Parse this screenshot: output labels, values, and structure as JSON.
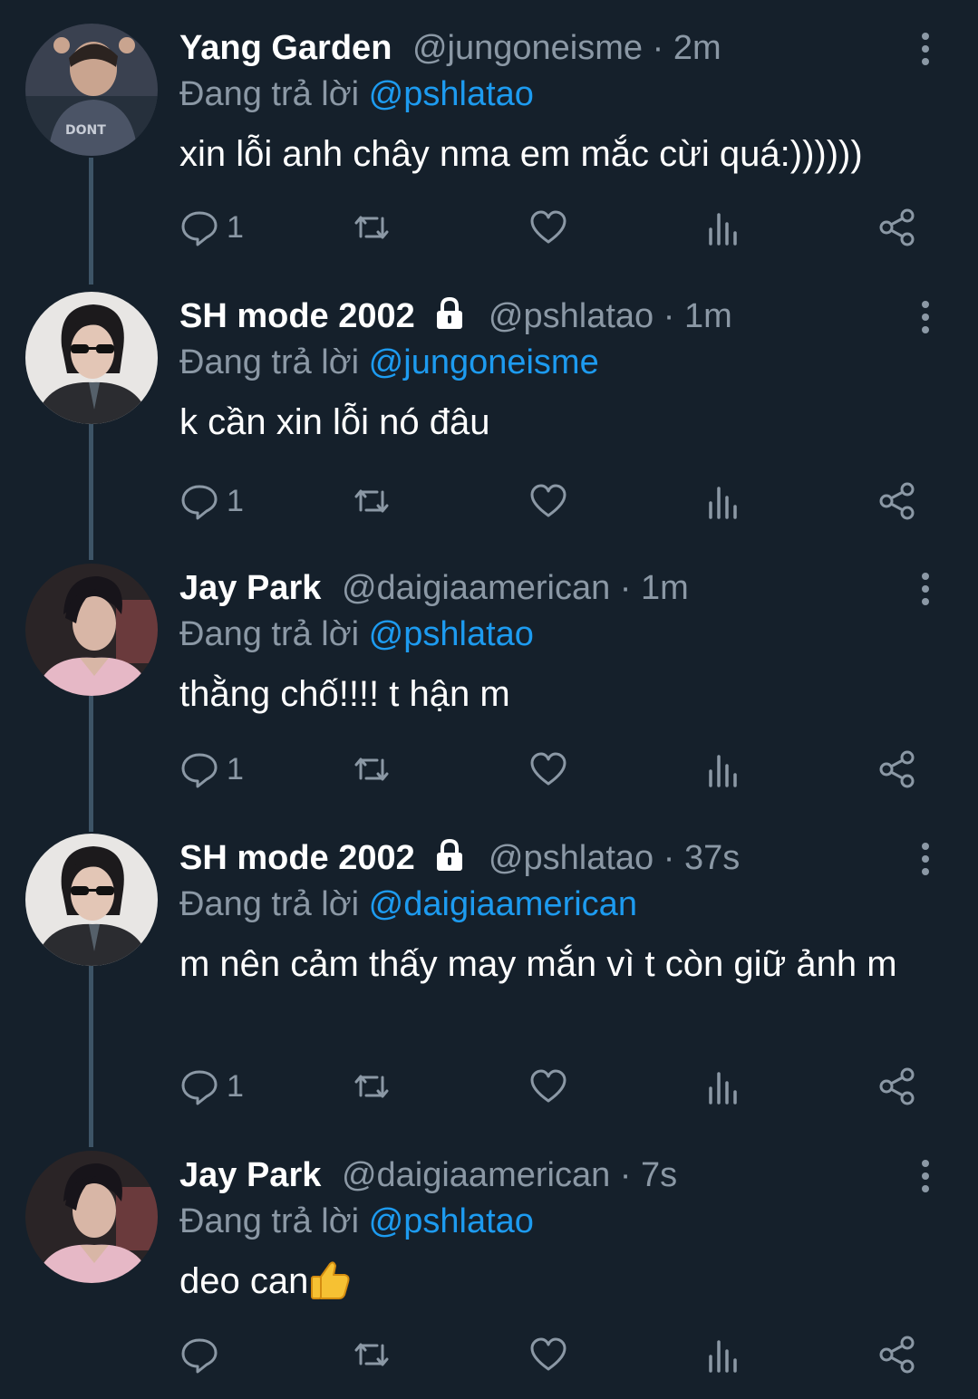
{
  "replying_label": "Đang trả lời",
  "separator": "·",
  "tweets": [
    {
      "name": "Yang Garden",
      "handle": "@jungoneisme",
      "time": "2m",
      "locked": false,
      "reply_to": "@pshlatao",
      "text": "xin lỗi anh chây nma em mắc cừi quá:))))))",
      "reply_count": "1"
    },
    {
      "name": "SH mode 2002",
      "handle": "@pshlatao",
      "time": "1m",
      "locked": true,
      "reply_to": "@jungoneisme",
      "text": "k cần xin lỗi nó đâu",
      "reply_count": "1"
    },
    {
      "name": "Jay Park",
      "handle": "@daigiaamerican",
      "time": "1m",
      "locked": false,
      "reply_to": "@pshlatao",
      "text": "thằng chố!!!! t hận m",
      "reply_count": "1"
    },
    {
      "name": "SH mode 2002",
      "handle": "@pshlatao",
      "time": "37s",
      "locked": true,
      "reply_to": "@daigiaamerican",
      "text": "m nên cảm thấy may mắn vì t còn giữ ảnh m",
      "reply_count": "1"
    },
    {
      "name": "Jay Park",
      "handle": "@daigiaamerican",
      "time": "7s",
      "locked": false,
      "reply_to": "@pshlatao",
      "text": "deo can",
      "emoji": "thumbs-up-emoji",
      "reply_count": ""
    }
  ],
  "icons": {
    "reply": "reply-icon",
    "retweet": "retweet-icon",
    "like": "heart-icon",
    "views": "views-icon",
    "share": "share-icon",
    "more": "more-vertical-icon",
    "lock": "lock-icon"
  },
  "colors": {
    "background": "#15202b",
    "text_primary": "#ffffff",
    "text_secondary": "#8b98a5",
    "mention": "#1d9bf0",
    "thread_line": "#3d5466"
  }
}
